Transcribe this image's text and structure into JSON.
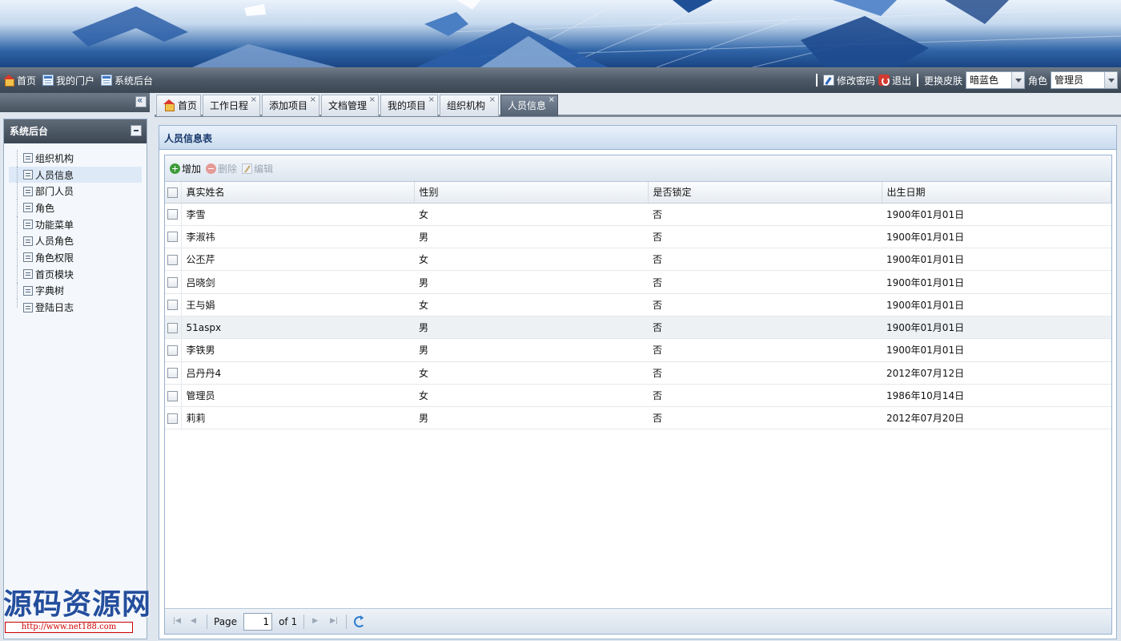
{
  "topbar": {
    "nav": [
      "首页",
      "我的门户",
      "系统后台"
    ],
    "change_password": "修改密码",
    "logout": "退出",
    "skin_label": "更换皮肤",
    "skin_value": "暗蓝色",
    "role_label": "角色",
    "role_value": "管理员"
  },
  "sidebar": {
    "title": "系统后台",
    "items": [
      "组织机构",
      "人员信息",
      "部门人员",
      "角色",
      "功能菜单",
      "人员角色",
      "角色权限",
      "首页模块",
      "字典树",
      "登陆日志"
    ],
    "selected_index": 1
  },
  "tabs": [
    {
      "label": "首页",
      "closable": false
    },
    {
      "label": "工作日程",
      "closable": true
    },
    {
      "label": "添加项目",
      "closable": true
    },
    {
      "label": "文档管理",
      "closable": true
    },
    {
      "label": "我的项目",
      "closable": true
    },
    {
      "label": "组织机构",
      "closable": true
    },
    {
      "label": "人员信息",
      "closable": true,
      "active": true
    }
  ],
  "panel": {
    "title": "人员信息表",
    "toolbar": {
      "add": "增加",
      "delete": "删除",
      "edit": "编辑"
    },
    "columns": [
      "真实姓名",
      "性别",
      "是否锁定",
      "出生日期"
    ],
    "rows": [
      [
        "李雪",
        "女",
        "否",
        "1900年01月01日"
      ],
      [
        "李淑祎",
        "男",
        "否",
        "1900年01月01日"
      ],
      [
        "公丕芹",
        "女",
        "否",
        "1900年01月01日"
      ],
      [
        "吕晓剑",
        "男",
        "否",
        "1900年01月01日"
      ],
      [
        "王与娟",
        "女",
        "否",
        "1900年01月01日"
      ],
      [
        "51aspx",
        "男",
        "否",
        "1900年01月01日"
      ],
      [
        "李铁男",
        "男",
        "否",
        "1900年01月01日"
      ],
      [
        "吕丹丹4",
        "女",
        "否",
        "2012年07月12日"
      ],
      [
        "管理员",
        "女",
        "否",
        "1986年10月14日"
      ],
      [
        "莉莉",
        "男",
        "否",
        "2012年07月20日"
      ]
    ],
    "highlighted_row": 5
  },
  "pager": {
    "page_label": "Page",
    "page_value": "1",
    "of_label": "of 1"
  },
  "watermark": {
    "text": "源码资源网",
    "url": "http://www.net188.com"
  }
}
